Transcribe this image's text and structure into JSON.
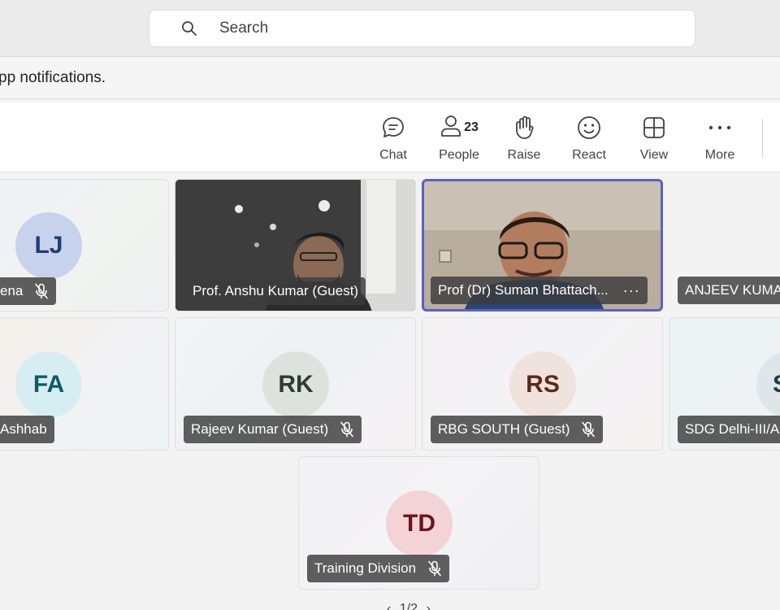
{
  "search": {
    "placeholder": "Search"
  },
  "notice": {
    "text": "pp notifications."
  },
  "toolbar": {
    "chat": "Chat",
    "people": "People",
    "people_count": "23",
    "raise": "Raise",
    "react": "React",
    "view": "View",
    "more": "More"
  },
  "participants": {
    "lj": {
      "initials": "LJ",
      "name": "ena"
    },
    "anshu": {
      "name": "Prof. Anshu Kumar (Guest)"
    },
    "suman": {
      "name": "Prof (Dr) Suman Bhattach...",
      "more": "···"
    },
    "anjeev": {
      "name": "ANJEEV KUMAR"
    },
    "fa": {
      "initials": "FA",
      "name": "Ashhab"
    },
    "rk": {
      "initials": "RK",
      "name": "Rajeev Kumar (Guest)"
    },
    "rs": {
      "initials": "RS",
      "name": "RBG SOUTH (Guest)"
    },
    "sdg": {
      "initials": "S",
      "name": "SDG Delhi-III/A"
    },
    "td": {
      "initials": "TD",
      "name": "Training Division"
    }
  },
  "pager": {
    "text": "1/2"
  },
  "colors": {
    "accent": "#5b5fc7",
    "avatar_lj": "#c7d3ec",
    "avatar_fa": "#d6eef2",
    "avatar_rk": "#dde3dc",
    "avatar_rs": "#f0e2dc",
    "avatar_td": "#f3d3d6"
  }
}
